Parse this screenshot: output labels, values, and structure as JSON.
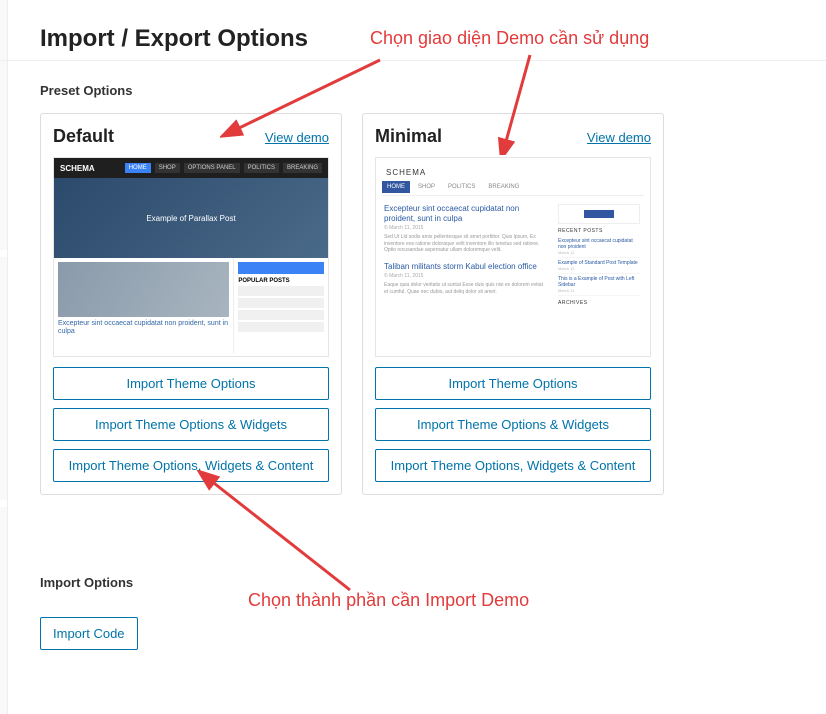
{
  "page": {
    "title": "Import / Export Options"
  },
  "preset_section": {
    "label": "Preset Options"
  },
  "presets": [
    {
      "title": "Default",
      "demo_link": "View demo",
      "thumb_brand": "SCHEMA",
      "thumb_hero_text": "Example of Parallax Post",
      "thumb_post_title": "Excepteur sint occaecat cupidatat non proident, sunt in culpa",
      "thumb_side_title": "POPULAR POSTS",
      "buttons": {
        "opts": "Import Theme Options",
        "opts_widgets": "Import Theme Options & Widgets",
        "opts_widgets_content": "Import Theme Options, Widgets & Content"
      }
    },
    {
      "title": "Minimal",
      "demo_link": "View demo",
      "thumb_brand": "SCHEMA",
      "thumb_post_title1": "Excepteur sint occaecat cupidatat non proident, sunt in culpa",
      "thumb_post_title2": "Taliban militants storm Kabul election office",
      "thumb_side_title": "RECENT POSTS",
      "buttons": {
        "opts": "Import Theme Options",
        "opts_widgets": "Import Theme Options & Widgets",
        "opts_widgets_content": "Import Theme Options, Widgets & Content"
      }
    }
  ],
  "import_section": {
    "label": "Import Options",
    "button": "Import Code"
  },
  "annotations": {
    "top": "Chọn giao diện Demo cần sử dụng",
    "bottom": "Chọn thành phần cần Import Demo"
  }
}
